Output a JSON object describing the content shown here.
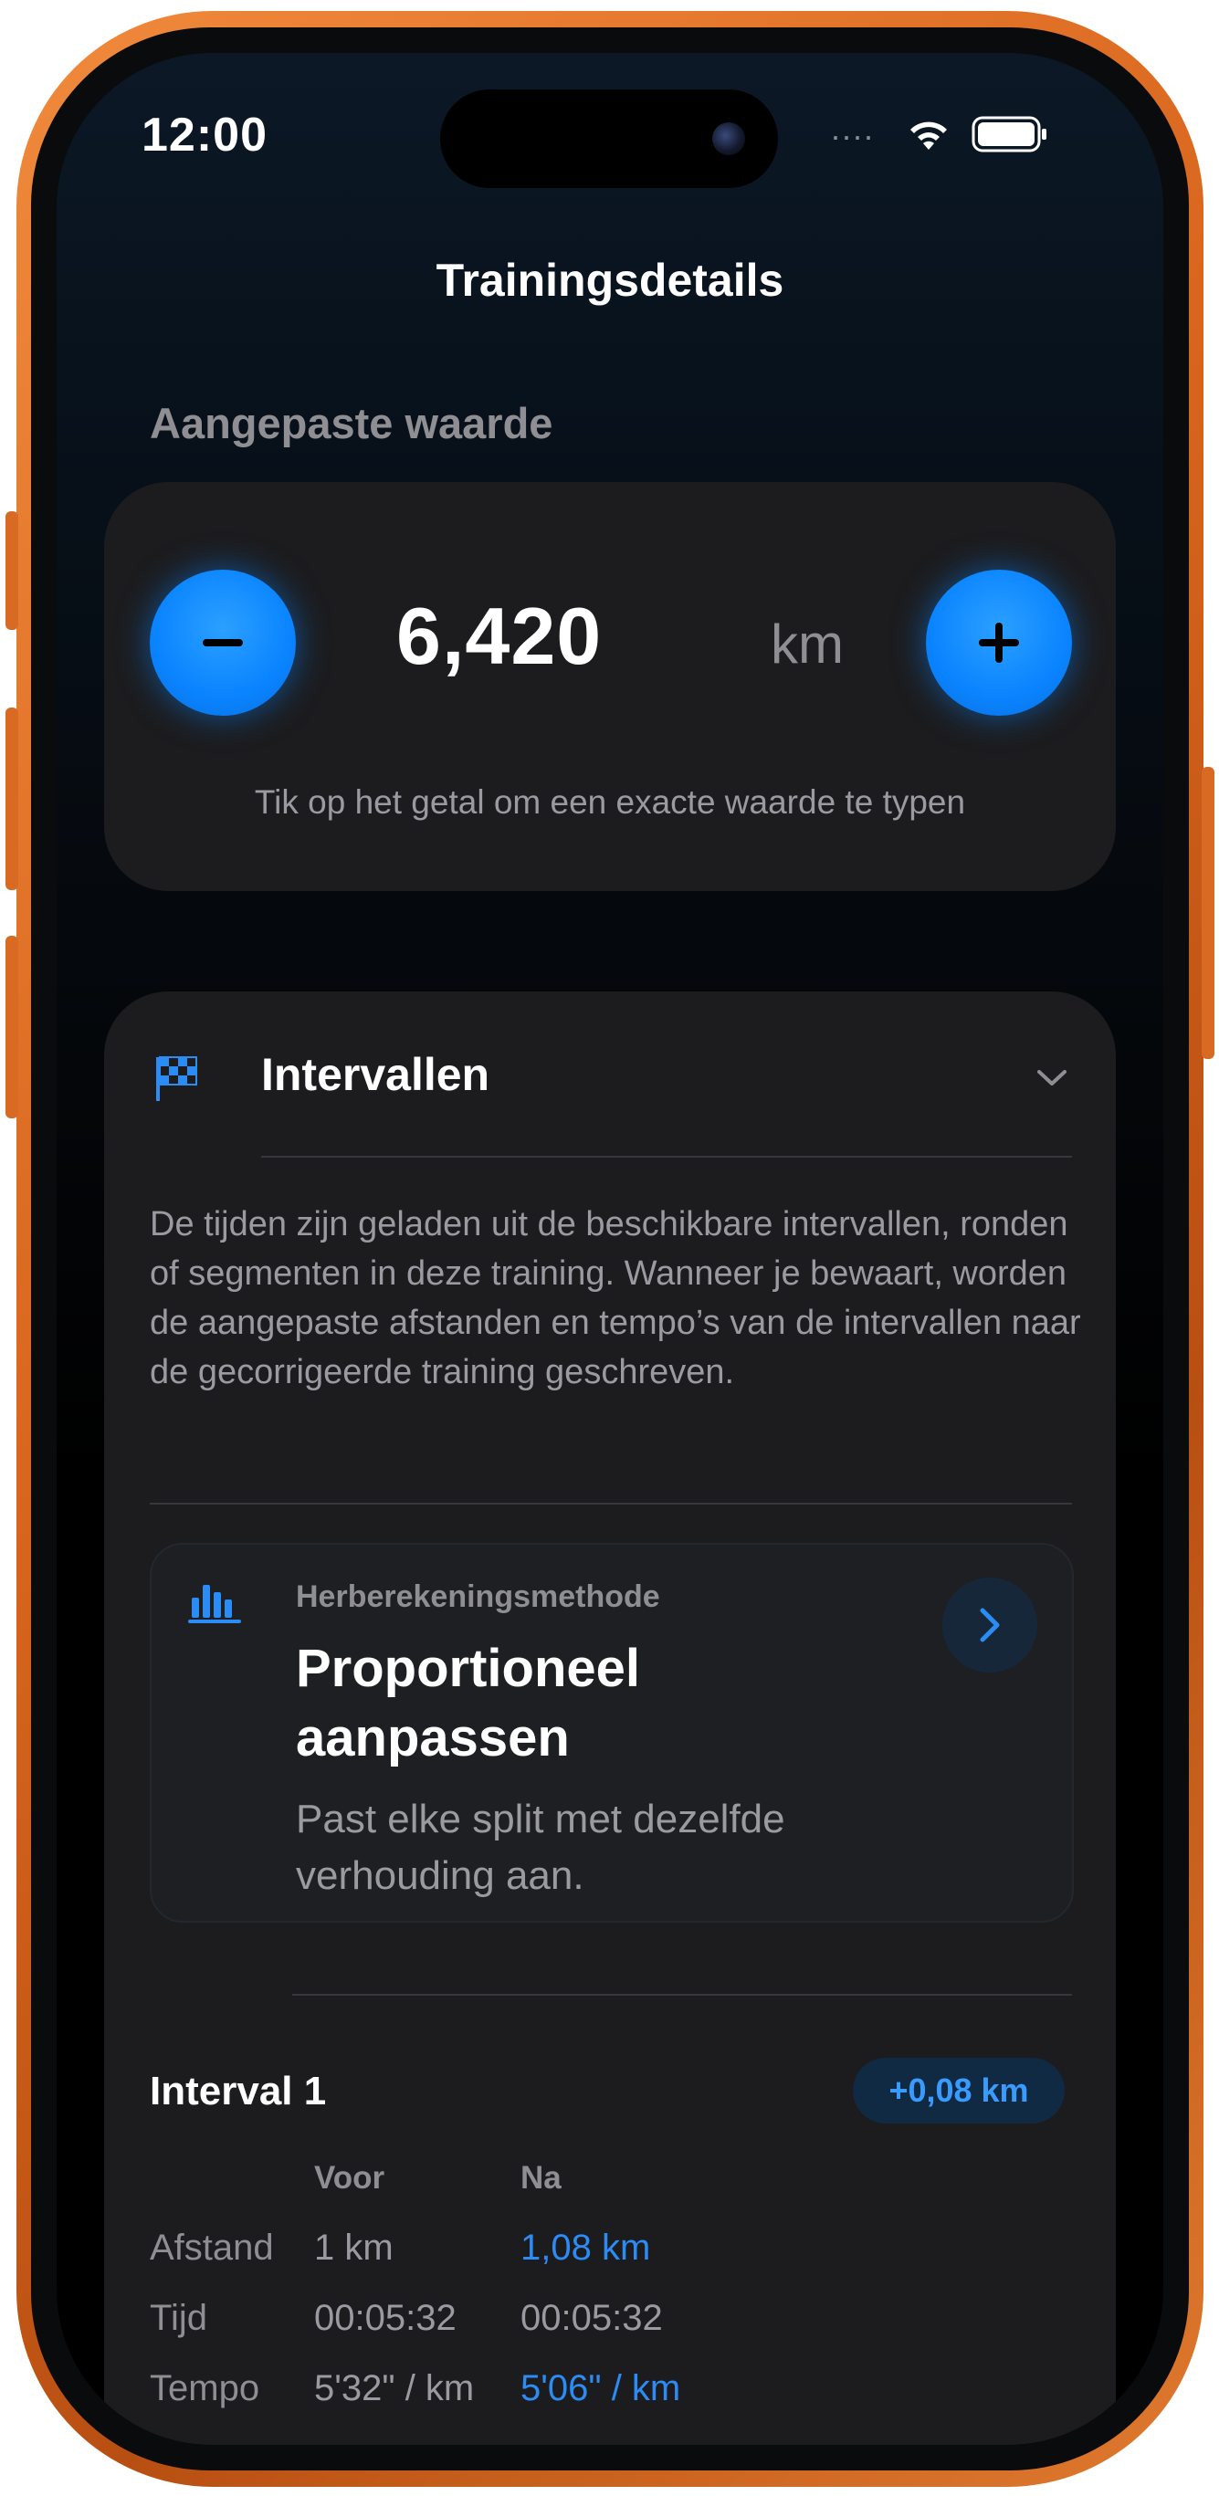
{
  "status_bar": {
    "time": "12:00",
    "signal_dots": "....",
    "wifi_icon": "wifi-icon",
    "battery_icon": "battery-icon"
  },
  "nav": {
    "title": "Trainingsdetails"
  },
  "adjusted_value": {
    "section_label": "Aangepaste waarde",
    "value": "6,420",
    "unit": "km",
    "hint": "Tik op het getal om een exacte waarde te typen",
    "decrement_icon": "minus-icon",
    "increment_icon": "plus-icon"
  },
  "intervals": {
    "icon": "checkered-flag-icon",
    "title": "Intervallen",
    "expanded_icon": "chevron-down-icon",
    "description": "De tijden zijn geladen uit de beschikbare intervallen, ronden of segmenten in deze training. Wanneer je bewaart, worden de aangepaste afstanden en tempo’s van de intervallen naar de gecorrigeerde training geschreven.",
    "method": {
      "icon": "bar-chart-icon",
      "kicker": "Herberekeningsmethode",
      "title": "Proportioneel aanpassen",
      "description": "Past elke split met dezelfde verhouding aan.",
      "arrow_icon": "chevron-right-icon"
    },
    "items": [
      {
        "name": "Interval 1",
        "delta": "+0,08 km",
        "col_before": "Voor",
        "col_after": "Na",
        "rows": [
          {
            "label": "Afstand",
            "before": "1 km",
            "after": "1,08 km",
            "changed": true
          },
          {
            "label": "Tijd",
            "before": "00:05:32",
            "after": "00:05:32",
            "changed": false
          },
          {
            "label": "Tempo",
            "before": "5'32\" / km",
            "after": "5'06\" / km",
            "changed": true
          }
        ]
      }
    ]
  },
  "colors": {
    "accent": "#0a84ff",
    "card": "#1c1c1e",
    "frame": "#e07a2f",
    "secondary_text": "#8e8e93"
  }
}
